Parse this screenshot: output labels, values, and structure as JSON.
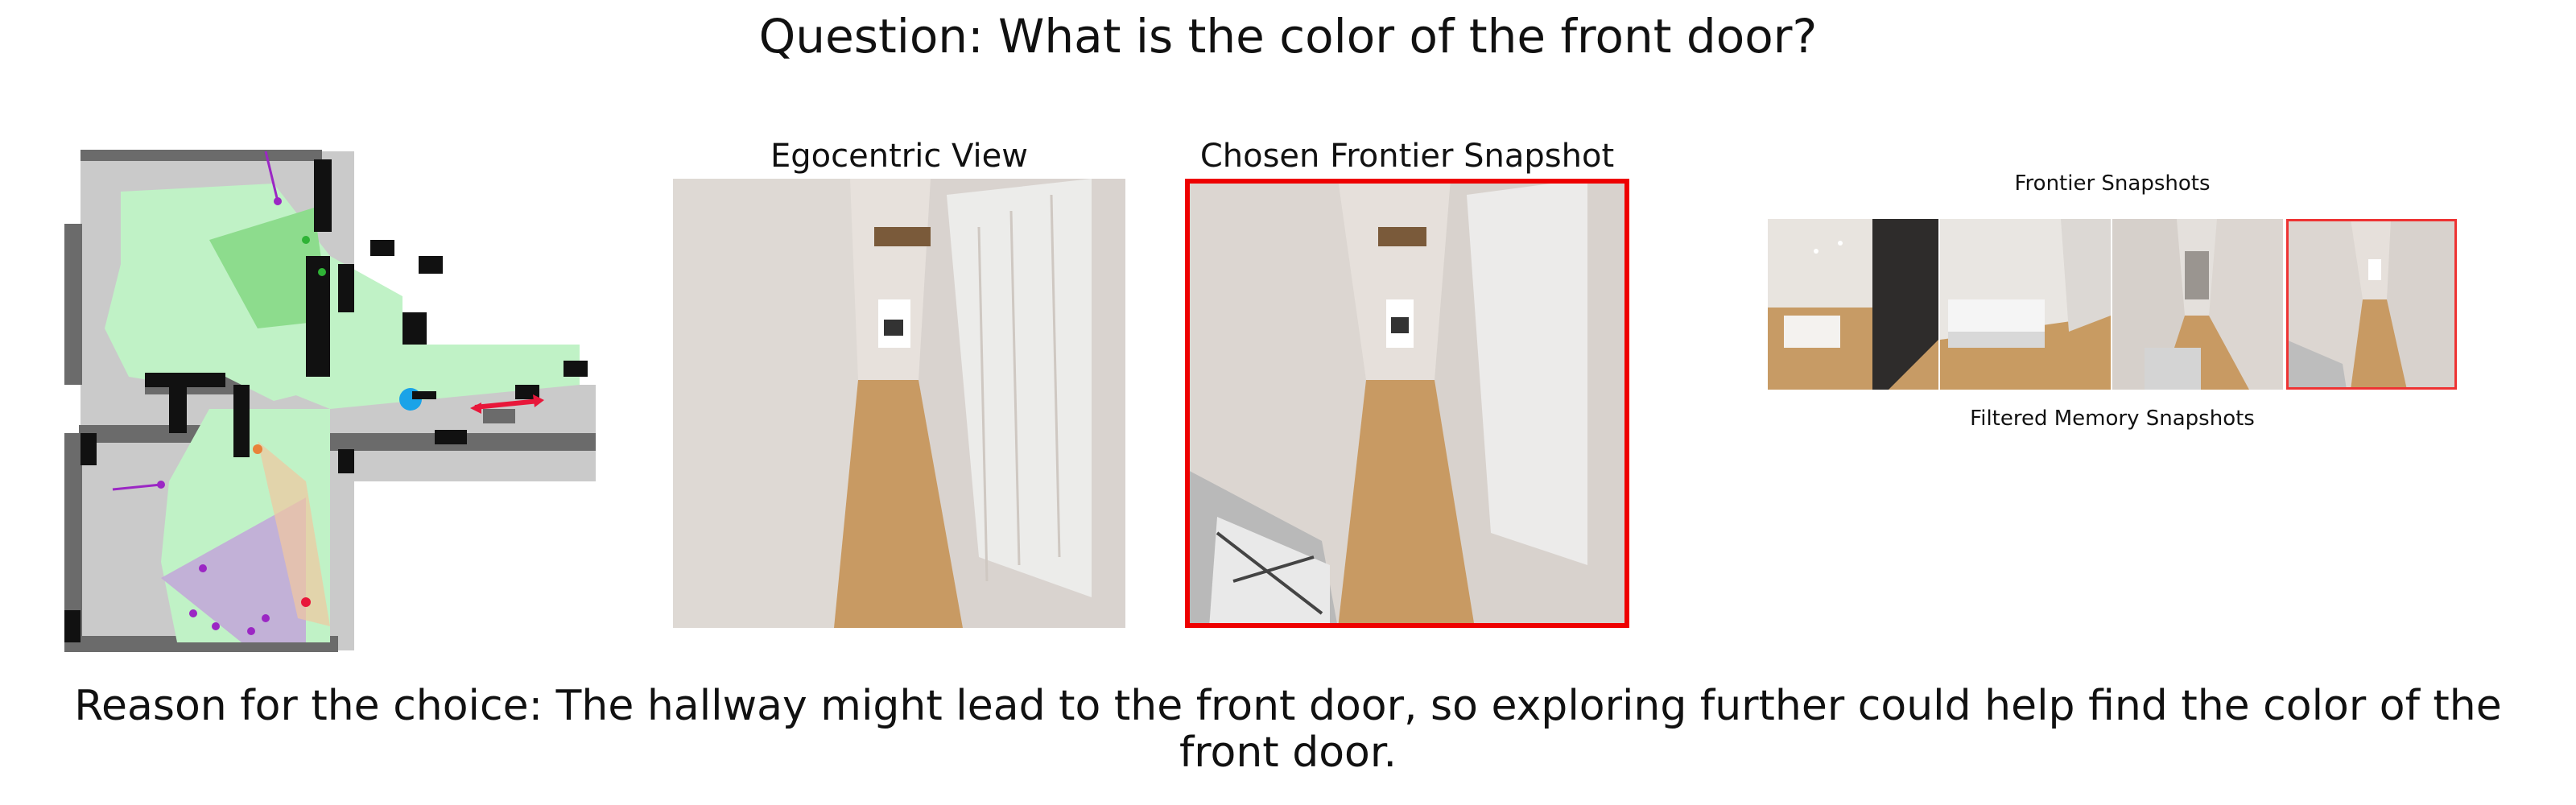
{
  "question": "Question: What is the color of the front door?",
  "panels": {
    "egocentric_label": "Egocentric View",
    "chosen_label": "Chosen Frontier Snapshot",
    "frontier_label": "Frontier Snapshots",
    "memory_label": "Filtered Memory Snapshots"
  },
  "frontier_thumbnails": [
    {
      "name": "living-room-snapshot",
      "selected": false
    },
    {
      "name": "bedroom-snapshot",
      "selected": false
    },
    {
      "name": "hallway-snapshot",
      "selected": false
    },
    {
      "name": "hallway-doorway-snapshot",
      "selected": true
    }
  ],
  "reason": "Reason for the choice: The hallway might lead to the front door, so exploring further could help find the color of the front door.",
  "colors": {
    "explored": "#c0f2c6",
    "obstacle": "#111111",
    "unknown_gray": "#c9c9c9",
    "wall_gray": "#6b6b6b",
    "agent": "#1aa3e8",
    "target_arrow": "#e8173a",
    "frontier_magenta": "#9b27c4",
    "frontier_green": "#2fb336",
    "selection": "#ee0000"
  }
}
